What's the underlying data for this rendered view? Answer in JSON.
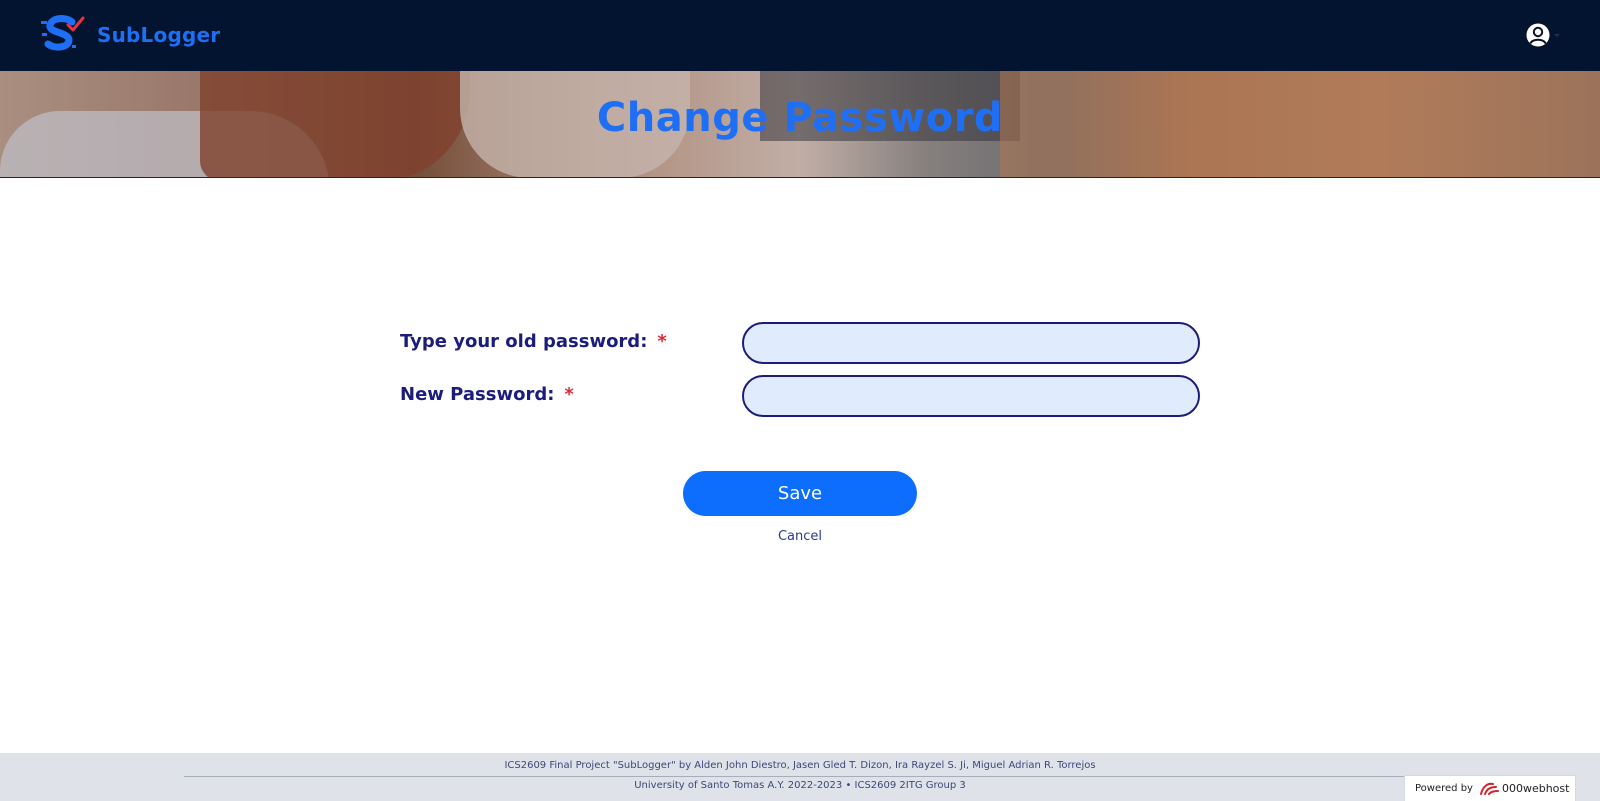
{
  "navbar": {
    "brand_name": "SubLogger",
    "brand_logo_icon": "sublogger-logo-icon",
    "user_icon": "user-circle-icon",
    "brand_color": "#1f6ff5",
    "background_color": "#02142f"
  },
  "hero": {
    "title": "Change Password",
    "title_color": "#1f6ff5"
  },
  "form": {
    "old_password": {
      "label": "Type your old password:",
      "required_mark": "*",
      "value": ""
    },
    "new_password": {
      "label": "New Password:",
      "required_mark": "*",
      "value": ""
    },
    "save_label": "Save",
    "cancel_label": "Cancel",
    "accent_color": "#0d6efd",
    "input_background": "#e0ebfd"
  },
  "footer": {
    "line1": "ICS2609 Final Project \"SubLogger\" by Alden John Diestro, Jasen Gled T. Dizon, Ira Rayzel S. Ji, Miguel Adrian R. Torrejos",
    "line2": "University of Santo Tomas A.Y. 2022-2023 • ICS2609 2ITG Group 3",
    "powered_by": "Powered by",
    "webhost_name": "000webhost",
    "webhost_icon": "000webhost-logo-icon"
  }
}
